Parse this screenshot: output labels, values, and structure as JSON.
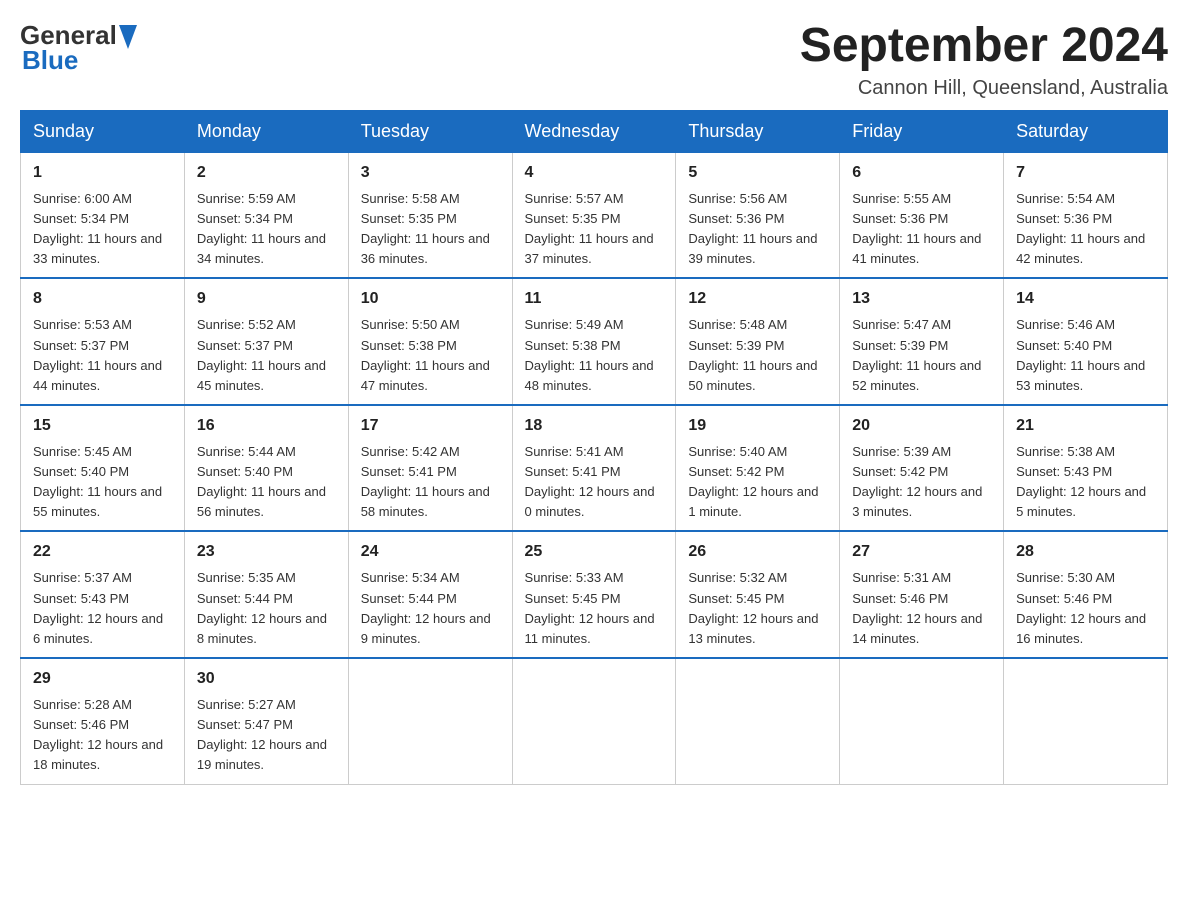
{
  "header": {
    "logo_general": "General",
    "logo_blue": "Blue",
    "month_title": "September 2024",
    "location": "Cannon Hill, Queensland, Australia"
  },
  "days_of_week": [
    "Sunday",
    "Monday",
    "Tuesday",
    "Wednesday",
    "Thursday",
    "Friday",
    "Saturday"
  ],
  "weeks": [
    [
      {
        "day": "1",
        "sunrise": "Sunrise: 6:00 AM",
        "sunset": "Sunset: 5:34 PM",
        "daylight": "Daylight: 11 hours and 33 minutes."
      },
      {
        "day": "2",
        "sunrise": "Sunrise: 5:59 AM",
        "sunset": "Sunset: 5:34 PM",
        "daylight": "Daylight: 11 hours and 34 minutes."
      },
      {
        "day": "3",
        "sunrise": "Sunrise: 5:58 AM",
        "sunset": "Sunset: 5:35 PM",
        "daylight": "Daylight: 11 hours and 36 minutes."
      },
      {
        "day": "4",
        "sunrise": "Sunrise: 5:57 AM",
        "sunset": "Sunset: 5:35 PM",
        "daylight": "Daylight: 11 hours and 37 minutes."
      },
      {
        "day": "5",
        "sunrise": "Sunrise: 5:56 AM",
        "sunset": "Sunset: 5:36 PM",
        "daylight": "Daylight: 11 hours and 39 minutes."
      },
      {
        "day": "6",
        "sunrise": "Sunrise: 5:55 AM",
        "sunset": "Sunset: 5:36 PM",
        "daylight": "Daylight: 11 hours and 41 minutes."
      },
      {
        "day": "7",
        "sunrise": "Sunrise: 5:54 AM",
        "sunset": "Sunset: 5:36 PM",
        "daylight": "Daylight: 11 hours and 42 minutes."
      }
    ],
    [
      {
        "day": "8",
        "sunrise": "Sunrise: 5:53 AM",
        "sunset": "Sunset: 5:37 PM",
        "daylight": "Daylight: 11 hours and 44 minutes."
      },
      {
        "day": "9",
        "sunrise": "Sunrise: 5:52 AM",
        "sunset": "Sunset: 5:37 PM",
        "daylight": "Daylight: 11 hours and 45 minutes."
      },
      {
        "day": "10",
        "sunrise": "Sunrise: 5:50 AM",
        "sunset": "Sunset: 5:38 PM",
        "daylight": "Daylight: 11 hours and 47 minutes."
      },
      {
        "day": "11",
        "sunrise": "Sunrise: 5:49 AM",
        "sunset": "Sunset: 5:38 PM",
        "daylight": "Daylight: 11 hours and 48 minutes."
      },
      {
        "day": "12",
        "sunrise": "Sunrise: 5:48 AM",
        "sunset": "Sunset: 5:39 PM",
        "daylight": "Daylight: 11 hours and 50 minutes."
      },
      {
        "day": "13",
        "sunrise": "Sunrise: 5:47 AM",
        "sunset": "Sunset: 5:39 PM",
        "daylight": "Daylight: 11 hours and 52 minutes."
      },
      {
        "day": "14",
        "sunrise": "Sunrise: 5:46 AM",
        "sunset": "Sunset: 5:40 PM",
        "daylight": "Daylight: 11 hours and 53 minutes."
      }
    ],
    [
      {
        "day": "15",
        "sunrise": "Sunrise: 5:45 AM",
        "sunset": "Sunset: 5:40 PM",
        "daylight": "Daylight: 11 hours and 55 minutes."
      },
      {
        "day": "16",
        "sunrise": "Sunrise: 5:44 AM",
        "sunset": "Sunset: 5:40 PM",
        "daylight": "Daylight: 11 hours and 56 minutes."
      },
      {
        "day": "17",
        "sunrise": "Sunrise: 5:42 AM",
        "sunset": "Sunset: 5:41 PM",
        "daylight": "Daylight: 11 hours and 58 minutes."
      },
      {
        "day": "18",
        "sunrise": "Sunrise: 5:41 AM",
        "sunset": "Sunset: 5:41 PM",
        "daylight": "Daylight: 12 hours and 0 minutes."
      },
      {
        "day": "19",
        "sunrise": "Sunrise: 5:40 AM",
        "sunset": "Sunset: 5:42 PM",
        "daylight": "Daylight: 12 hours and 1 minute."
      },
      {
        "day": "20",
        "sunrise": "Sunrise: 5:39 AM",
        "sunset": "Sunset: 5:42 PM",
        "daylight": "Daylight: 12 hours and 3 minutes."
      },
      {
        "day": "21",
        "sunrise": "Sunrise: 5:38 AM",
        "sunset": "Sunset: 5:43 PM",
        "daylight": "Daylight: 12 hours and 5 minutes."
      }
    ],
    [
      {
        "day": "22",
        "sunrise": "Sunrise: 5:37 AM",
        "sunset": "Sunset: 5:43 PM",
        "daylight": "Daylight: 12 hours and 6 minutes."
      },
      {
        "day": "23",
        "sunrise": "Sunrise: 5:35 AM",
        "sunset": "Sunset: 5:44 PM",
        "daylight": "Daylight: 12 hours and 8 minutes."
      },
      {
        "day": "24",
        "sunrise": "Sunrise: 5:34 AM",
        "sunset": "Sunset: 5:44 PM",
        "daylight": "Daylight: 12 hours and 9 minutes."
      },
      {
        "day": "25",
        "sunrise": "Sunrise: 5:33 AM",
        "sunset": "Sunset: 5:45 PM",
        "daylight": "Daylight: 12 hours and 11 minutes."
      },
      {
        "day": "26",
        "sunrise": "Sunrise: 5:32 AM",
        "sunset": "Sunset: 5:45 PM",
        "daylight": "Daylight: 12 hours and 13 minutes."
      },
      {
        "day": "27",
        "sunrise": "Sunrise: 5:31 AM",
        "sunset": "Sunset: 5:46 PM",
        "daylight": "Daylight: 12 hours and 14 minutes."
      },
      {
        "day": "28",
        "sunrise": "Sunrise: 5:30 AM",
        "sunset": "Sunset: 5:46 PM",
        "daylight": "Daylight: 12 hours and 16 minutes."
      }
    ],
    [
      {
        "day": "29",
        "sunrise": "Sunrise: 5:28 AM",
        "sunset": "Sunset: 5:46 PM",
        "daylight": "Daylight: 12 hours and 18 minutes."
      },
      {
        "day": "30",
        "sunrise": "Sunrise: 5:27 AM",
        "sunset": "Sunset: 5:47 PM",
        "daylight": "Daylight: 12 hours and 19 minutes."
      },
      null,
      null,
      null,
      null,
      null
    ]
  ]
}
